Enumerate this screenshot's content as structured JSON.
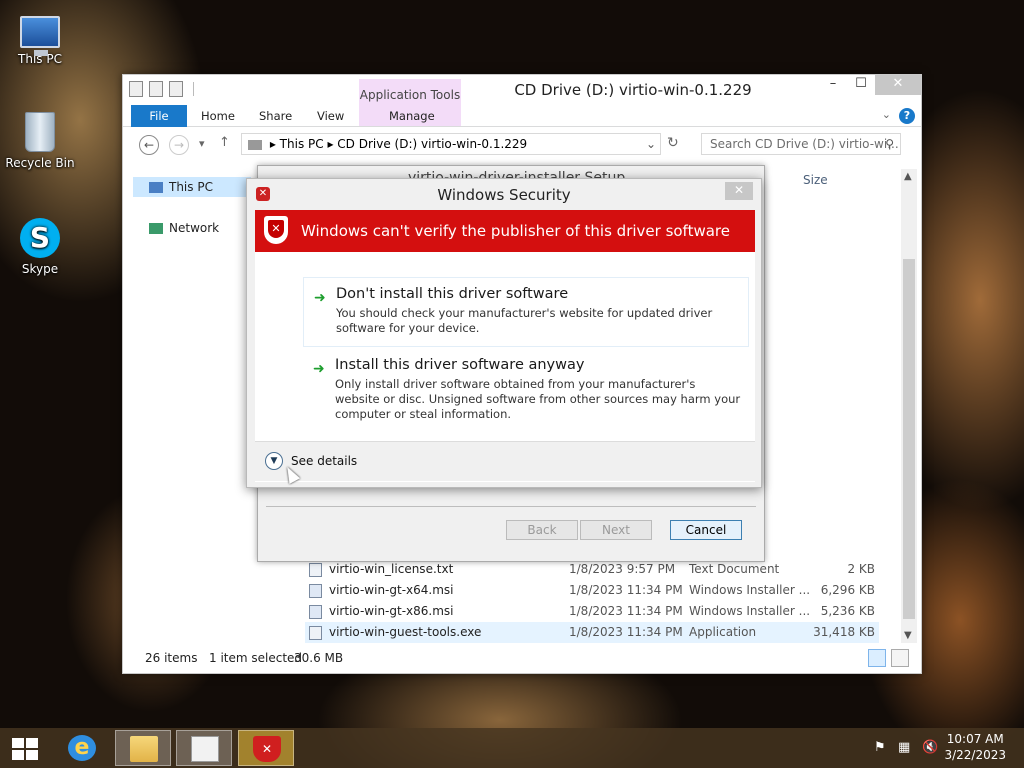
{
  "desktop": {
    "icons": [
      {
        "label": "This PC"
      },
      {
        "label": "Recycle Bin"
      },
      {
        "label": "Skype"
      }
    ]
  },
  "explorer": {
    "title": "CD Drive (D:) virtio-win-0.1.229",
    "context_tab_group": "Application Tools",
    "tabs": {
      "file": "File",
      "home": "Home",
      "share": "Share",
      "view": "View",
      "manage": "Manage"
    },
    "address": {
      "crumbs": [
        "This PC",
        "CD Drive (D:) virtio-win-0.1.229"
      ]
    },
    "search_placeholder": "Search CD Drive (D:) virtio-wi...",
    "nav": {
      "this_pc": "This PC",
      "network": "Network"
    },
    "column_size": "Size",
    "files": [
      {
        "name": "virtio-win_license.txt",
        "date": "1/8/2023 9:57 PM",
        "type": "Text Document",
        "size": "2 KB"
      },
      {
        "name": "virtio-win-gt-x64.msi",
        "date": "1/8/2023 11:34 PM",
        "type": "Windows Installer ...",
        "size": "6,296 KB"
      },
      {
        "name": "virtio-win-gt-x86.msi",
        "date": "1/8/2023 11:34 PM",
        "type": "Windows Installer ...",
        "size": "5,236 KB"
      },
      {
        "name": "virtio-win-guest-tools.exe",
        "date": "1/8/2023 11:34 PM",
        "type": "Application",
        "size": "31,418 KB"
      }
    ],
    "status": {
      "items": "26 items",
      "selected": "1 item selected",
      "size": "30.6 MB"
    }
  },
  "installer": {
    "title": "virtio-win-driver-installer Setup",
    "buttons": {
      "back": "Back",
      "next": "Next",
      "cancel": "Cancel"
    }
  },
  "security_dialog": {
    "title": "Windows Security",
    "banner": "Windows can't verify the publisher of this driver software",
    "options": [
      {
        "heading": "Don't install this driver software",
        "description": "You should check your manufacturer's website for updated driver software for your device."
      },
      {
        "heading": "Install this driver software anyway",
        "description": "Only install driver software obtained from your manufacturer's website or disc. Unsigned software from other sources may harm your computer or steal information."
      }
    ],
    "see_details": "See details"
  },
  "taskbar": {
    "time": "10:07 AM",
    "date": "3/22/2023"
  },
  "colors": {
    "accent": "#1979ca",
    "banner_red": "#d40f0f",
    "arrow_green": "#1e9e2e"
  }
}
